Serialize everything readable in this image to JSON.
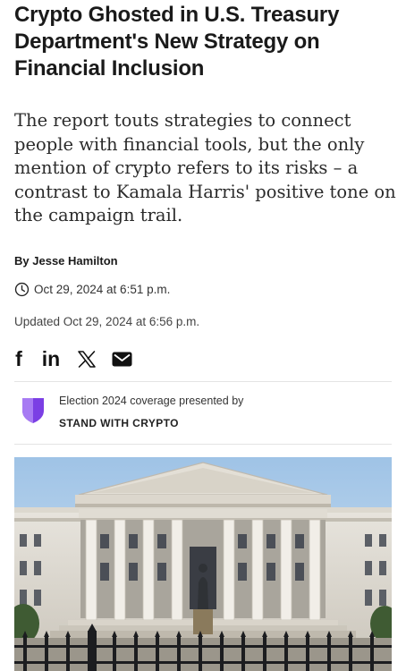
{
  "article": {
    "headline": "Crypto Ghosted in U.S. Treasury Department's New Strategy on Financial Inclusion",
    "dek": "The report touts strategies to connect people with financial tools, but the only mention of crypto refers to its risks – a contrast to Kamala Harris' positive tone on the campaign trail.",
    "byline_prefix": "By",
    "author": "Jesse Hamilton",
    "published": "Oct 29, 2024 at 6:51 p.m.",
    "updated": "Updated Oct 29, 2024 at 6:56 p.m."
  },
  "share": {
    "facebook_label": "f",
    "linkedin_label": "in",
    "icons": [
      "facebook-icon",
      "linkedin-icon",
      "x-icon",
      "email-icon"
    ]
  },
  "sponsor": {
    "presented_text": "Election 2024 coverage presented by",
    "brand": "STAND WITH CRYPTO",
    "brand_color": "#7b3fe4"
  },
  "hero": {
    "icon": "treasury-building-photo"
  }
}
